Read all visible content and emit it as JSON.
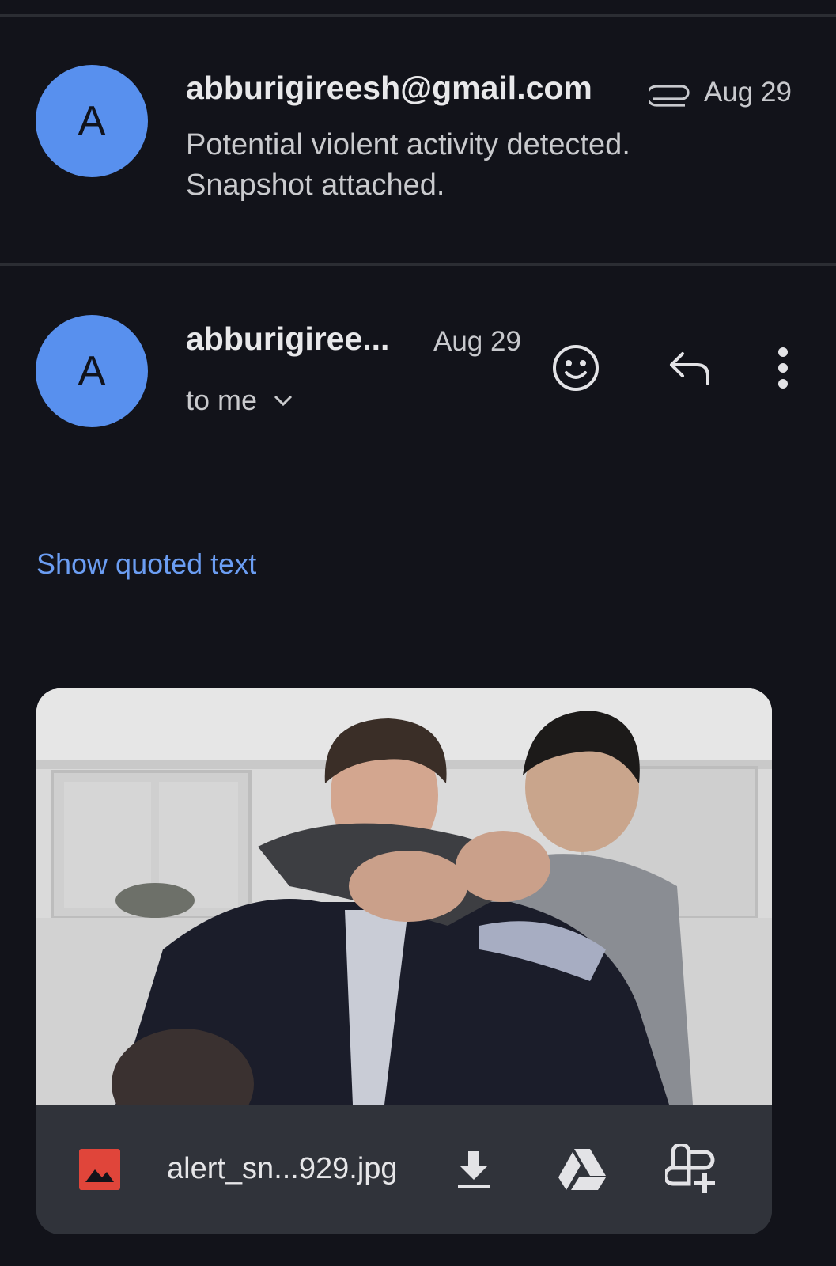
{
  "thread_item": {
    "avatar_letter": "A",
    "sender": "abburigireesh@gmail.com",
    "date": "Aug 29",
    "snippet": "Potential violent activity detected. Snapshot attached."
  },
  "message": {
    "avatar_letter": "A",
    "sender": "abburigiree...",
    "date": "Aug 29",
    "recipient": "to me",
    "show_quoted_label": "Show quoted text"
  },
  "attachment": {
    "file_name": "alert_sn...929.jpg"
  },
  "icons": {
    "attachment": "paperclip-icon",
    "emoji": "add-reaction-icon",
    "reply": "reply-icon",
    "more": "more-vert-icon",
    "expand": "chevron-down-icon",
    "file_type": "image-file-icon",
    "download": "download-icon",
    "drive": "google-drive-icon",
    "photos": "add-to-photos-icon"
  },
  "colors": {
    "background": "#12131a",
    "avatar": "#5890ee",
    "link": "#6b9df2",
    "file_icon": "#e0453a",
    "attachment_bar": "#30333a"
  }
}
